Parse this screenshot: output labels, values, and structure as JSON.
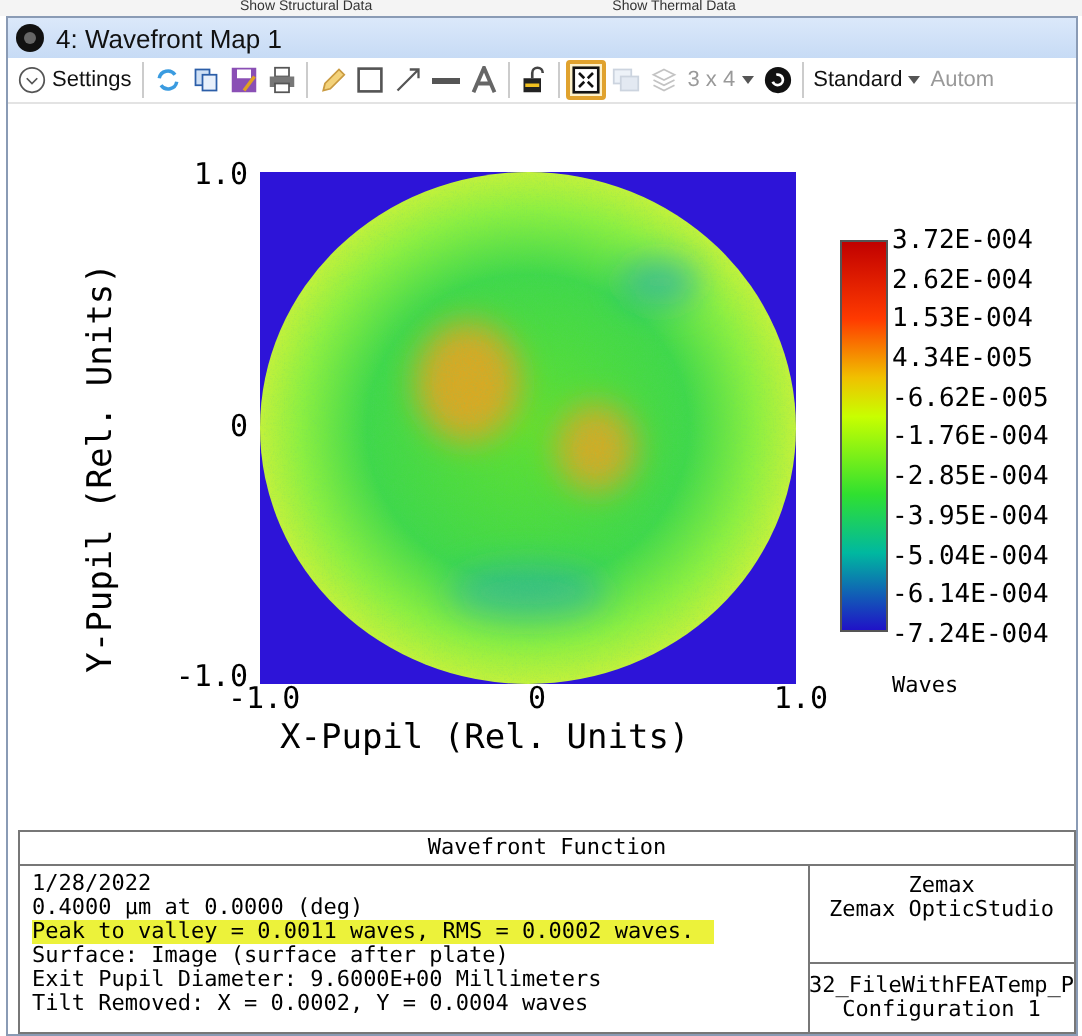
{
  "background_strip": {
    "items": [
      "Show Structural Data",
      "Show Thermal Data"
    ]
  },
  "window": {
    "title": "4: Wavefront Map 1"
  },
  "toolbar": {
    "items": [
      {
        "kind": "settings",
        "label": "Settings",
        "disabled": false,
        "selected": false
      },
      {
        "kind": "sep"
      },
      {
        "kind": "refresh",
        "disabled": false,
        "selected": false
      },
      {
        "kind": "copy",
        "disabled": false,
        "selected": false
      },
      {
        "kind": "save",
        "disabled": false,
        "selected": false
      },
      {
        "kind": "print",
        "disabled": false,
        "selected": false
      },
      {
        "kind": "sep"
      },
      {
        "kind": "pencil",
        "disabled": false,
        "selected": false
      },
      {
        "kind": "rect",
        "disabled": false,
        "selected": false
      },
      {
        "kind": "arrow",
        "disabled": false,
        "selected": false
      },
      {
        "kind": "line",
        "disabled": false,
        "selected": false
      },
      {
        "kind": "text",
        "disabled": false,
        "selected": false
      },
      {
        "kind": "sep"
      },
      {
        "kind": "lock",
        "disabled": false,
        "selected": false
      },
      {
        "kind": "sep"
      },
      {
        "kind": "frame",
        "disabled": false,
        "selected": true
      },
      {
        "kind": "windows",
        "disabled": true,
        "selected": false
      },
      {
        "kind": "layers",
        "disabled": true,
        "selected": false
      },
      {
        "kind": "dropdown",
        "label": "3 x 4",
        "disabled": true,
        "selected": false
      },
      {
        "kind": "cycle",
        "disabled": false,
        "selected": false
      },
      {
        "kind": "sep"
      },
      {
        "kind": "dropdown",
        "label": "Standard",
        "disabled": false,
        "selected": false
      },
      {
        "kind": "label",
        "label": "Autom",
        "disabled": true,
        "selected": false
      }
    ]
  },
  "plot": {
    "ylabel": "Y-Pupil (Rel. Units)",
    "xlabel": "X-Pupil (Rel. Units)",
    "yticks": [
      "1.0",
      "0",
      "-1.0"
    ],
    "xticks": [
      "-1.0",
      "0",
      "1.0"
    ],
    "colorbar": {
      "ticks": [
        "3.72E-004",
        "2.62E-004",
        "1.53E-004",
        "4.34E-005",
        "-6.62E-005",
        "-1.76E-004",
        "-2.85E-004",
        "-3.95E-004",
        "-5.04E-004",
        "-6.14E-004",
        "-7.24E-004"
      ],
      "unit": "Waves"
    }
  },
  "info_panel": {
    "title": "Wavefront Function",
    "lines": [
      {
        "text": "1/28/2022",
        "highlighted": false
      },
      {
        "text": "0.4000 µm at 0.0000 (deg)",
        "highlighted": false
      },
      {
        "text": "Peak to valley = 0.0011 waves, RMS = 0.0002 waves.",
        "highlighted": true
      },
      {
        "text": "Surface: Image (surface after plate)",
        "highlighted": false
      },
      {
        "text": "Exit Pupil Diameter: 9.6000E+00 Millimeters",
        "highlighted": false
      },
      {
        "text": "Tilt Removed: X = 0.0002, Y = 0.0004 waves",
        "highlighted": false
      }
    ],
    "company": [
      "Zemax",
      "Zemax OpticStudio"
    ],
    "file": [
      "32_FileWithFEATemp_P",
      "Configuration 1"
    ]
  }
}
